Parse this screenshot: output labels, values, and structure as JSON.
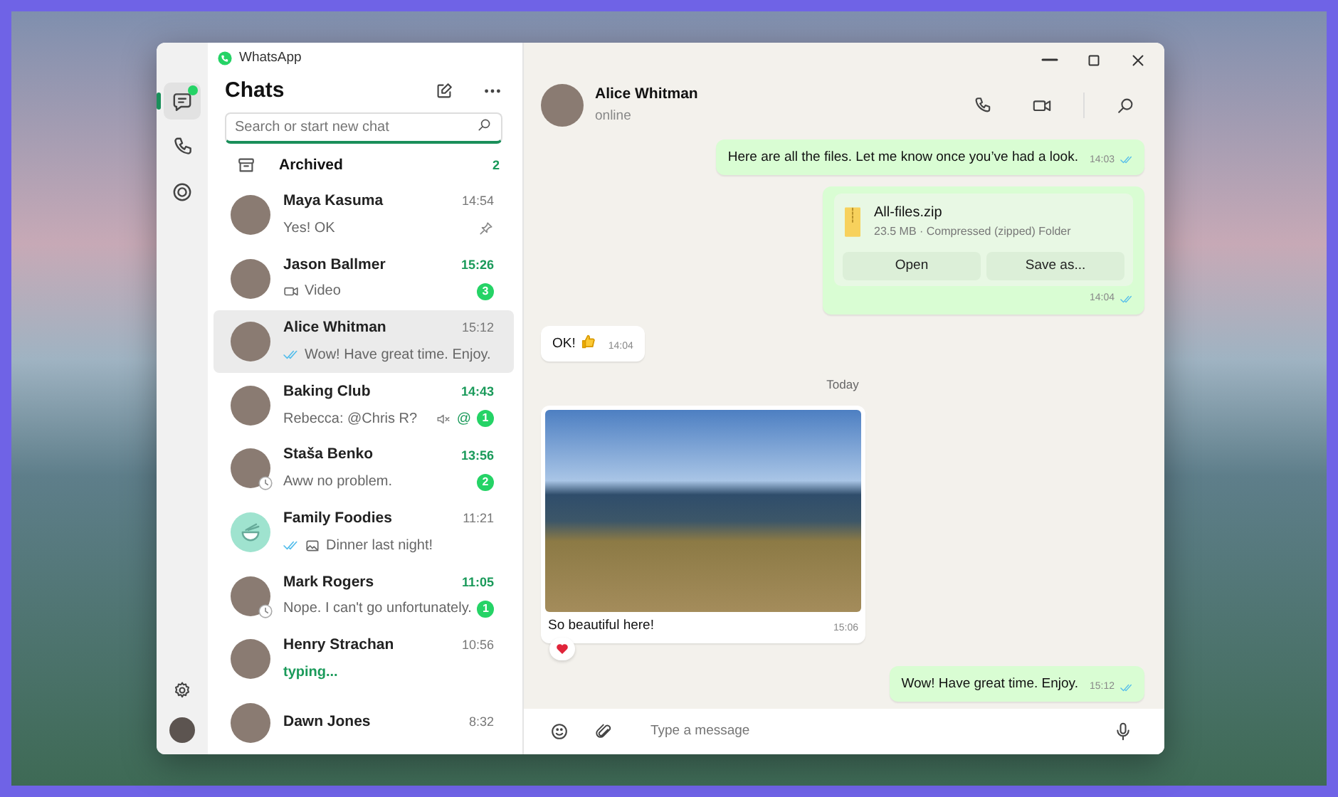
{
  "window": {
    "title": "WhatsApp"
  },
  "rail": {
    "items": [
      {
        "kind": "chats",
        "selected": true,
        "has_update": true
      },
      {
        "kind": "calls",
        "selected": false
      },
      {
        "kind": "status",
        "selected": false
      }
    ]
  },
  "chat_list": {
    "title": "Chats",
    "search": {
      "placeholder": "Search or start new chat"
    },
    "archived": {
      "label": "Archived",
      "count": "2"
    },
    "chats": [
      {
        "name": "Maya Kasuma",
        "time": "14:54",
        "preview": "Yes! OK",
        "selected": false,
        "pinned": true
      },
      {
        "name": "Jason Ballmer",
        "time": "15:26",
        "preview": "Video",
        "video": true,
        "unread": "3",
        "selected": false
      },
      {
        "name": "Alice Whitman",
        "time": "15:12",
        "preview": "Wow! Have great time. Enjoy.",
        "read": true,
        "selected": true
      },
      {
        "name": "Baking Club",
        "time": "14:43",
        "preview": "Rebecca: @Chris R?",
        "muted": true,
        "mention": "@",
        "unread": "1",
        "selected": false
      },
      {
        "name": "Staša Benko",
        "time": "13:56",
        "preview": "Aww no problem.",
        "status_badge": true,
        "unread": "2",
        "selected": false
      },
      {
        "name": "Family Foodies",
        "time": "11:21",
        "preview": "Dinner last night!",
        "group": true,
        "read": true,
        "photo": true,
        "selected": false
      },
      {
        "name": "Mark Rogers",
        "time": "11:05",
        "preview": "Nope. I can't go unfortunately.",
        "status_badge": true,
        "unread": "1",
        "selected": false
      },
      {
        "name": "Henry Strachan",
        "time": "10:56",
        "preview": "typing...",
        "typing": true,
        "selected": false
      },
      {
        "name": "Dawn Jones",
        "time": "8:32",
        "selected": false
      }
    ]
  },
  "conversation": {
    "contact": {
      "name": "Alice Whitman",
      "status": "online"
    },
    "messages": [
      {
        "kind": "text",
        "outgoing": true,
        "text": "Here are all the files. Let me know once you’ve had a look.",
        "time": "14:03",
        "read": true
      },
      {
        "kind": "file",
        "outgoing": true,
        "file_name": "All-files.zip",
        "file_info": "23.5 MB · Compressed (zipped) Folder",
        "actions": [
          "Open",
          "Save as..."
        ],
        "time": "14:04",
        "read": true
      },
      {
        "kind": "text",
        "outgoing": false,
        "text": "OK!",
        "thumbs_up": true,
        "time": "14:04"
      },
      {
        "kind": "date",
        "text": "Today"
      },
      {
        "kind": "image",
        "outgoing": false,
        "caption": "So beautiful here!",
        "time": "15:06",
        "heart_reaction": true
      },
      {
        "kind": "text",
        "outgoing": true,
        "text": "Wow! Have great time. Enjoy.",
        "time": "15:12",
        "read": true
      }
    ],
    "composer": {
      "placeholder": "Type a message"
    }
  }
}
